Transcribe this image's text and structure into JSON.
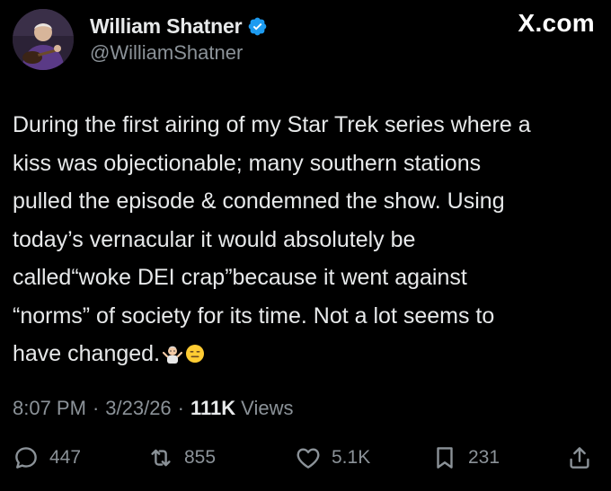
{
  "author": {
    "display_name": "William Shatner",
    "handle": "@WilliamShatner",
    "verified": true,
    "avatar_icon": "avatar-photo"
  },
  "brand": {
    "label": "X.com"
  },
  "post": {
    "text": "During the first airing of my Star Trek series where a\nkiss was objectionable; many southern stations\npulled the episode & condemned the show. Using\ntoday’s vernacular it would absolutely be\ncalled“woke DEI crap”because it went against\n“norms” of society for its time. Not a lot seems to\nhave changed.",
    "emojis": [
      "man-shrugging-emoji",
      "expressionless-face-emoji"
    ]
  },
  "meta": {
    "time": "8:07 PM",
    "date": "3/23/26",
    "views_count": "111K",
    "views_label": "Views"
  },
  "actions": {
    "replies": "447",
    "reposts": "855",
    "likes": "5.1K",
    "bookmarks": "231"
  },
  "colors": {
    "background": "#000000",
    "text_primary": "#e7e9ea",
    "text_secondary": "#8b9298",
    "verified_blue": "#1d9bf0"
  }
}
